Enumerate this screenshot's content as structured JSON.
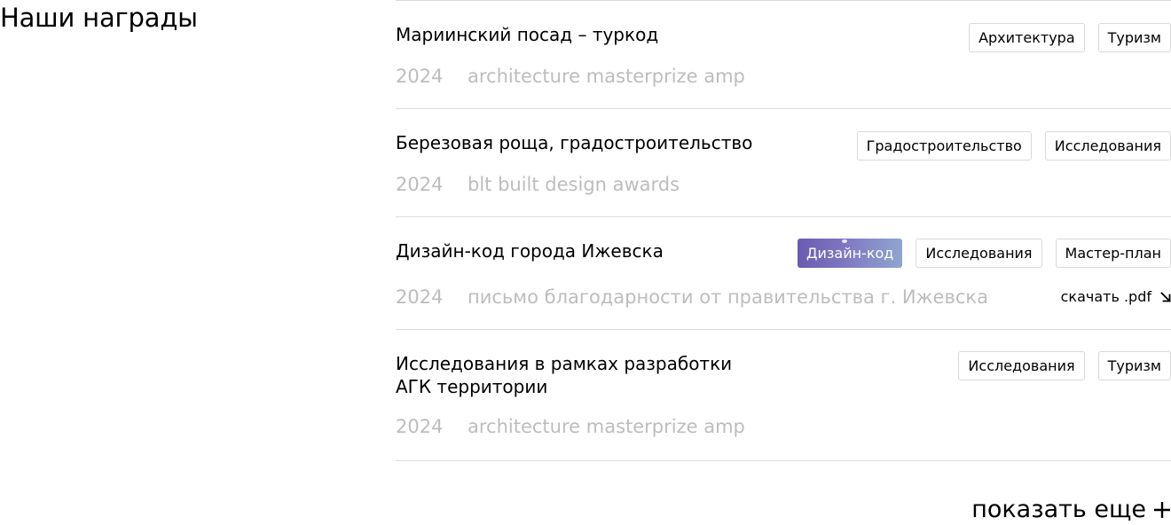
{
  "section": {
    "title": "Наши награды"
  },
  "awards": [
    {
      "title": "Мариинский посад – туркод",
      "year": "2024",
      "name": "architecture masterprize amp",
      "tags": [
        "Архитектура",
        "Туризм"
      ]
    },
    {
      "title": "Березовая роща, градостроительство",
      "year": "2024",
      "name": "blt built design awards",
      "tags": [
        "Градостроительство",
        "Исследования"
      ]
    },
    {
      "title": "Дизайн-код города Ижевска",
      "year": "2024",
      "name": "письмо благодарности от правительства г. Ижевска",
      "tags": [
        "Дизайн-код",
        "Исследования",
        "Мастер-план"
      ],
      "download_label": "скачать .pdf",
      "download_icon": "arrow-down-right-icon"
    },
    {
      "title": "Исследования в рамках разработки АГК территории",
      "year": "2024",
      "name": "architecture masterprize amp",
      "tags": [
        "Исследования",
        "Туризм"
      ]
    }
  ],
  "show_more": {
    "label": "показать еще",
    "icon": "plus-icon"
  },
  "colors": {
    "text": "#000000",
    "muted": "#bdbdbd",
    "divider": "#dcdcdc",
    "tag_border": "#d9d9d9",
    "active_tag_gradient_start": "#6a5bb0",
    "active_tag_gradient_end": "#8fa6cf"
  }
}
